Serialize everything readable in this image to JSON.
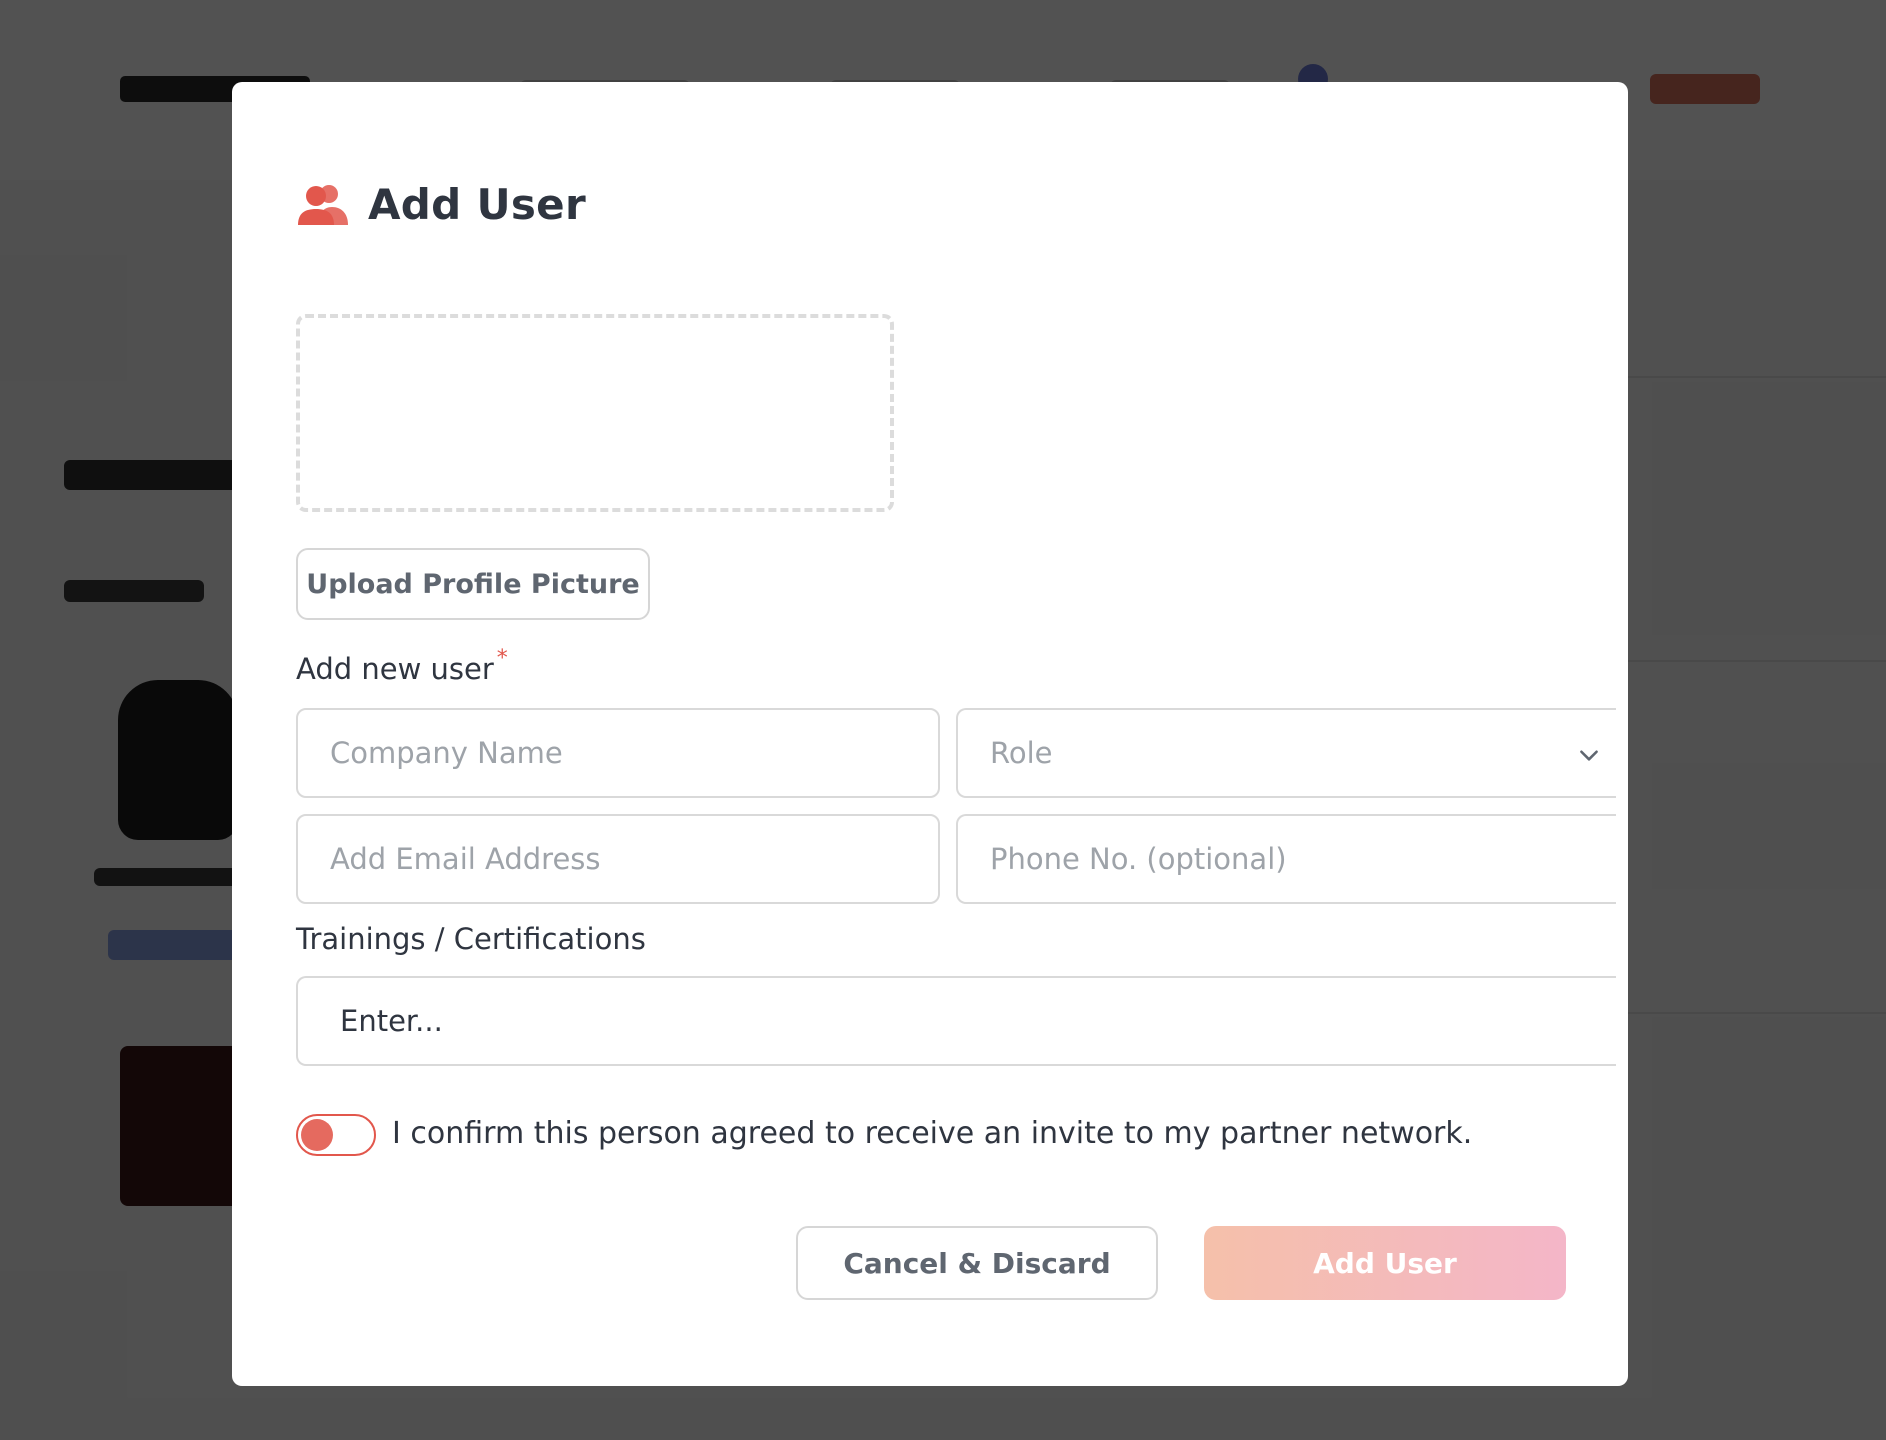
{
  "modal": {
    "title": "Add User",
    "title_icon": "users-icon",
    "upload_button_label": "Upload Profile Picture",
    "add_new_user_label": "Add new user",
    "required_mark": "*",
    "fields": {
      "company_name_placeholder": "Company Name",
      "role_value": "Role",
      "email_placeholder": "Add Email Address",
      "phone_placeholder": "Phone No. (optional)"
    },
    "trainings_label": "Trainings / Certifications",
    "trainings_placeholder": "Enter...",
    "consent_text": "I confirm this person agreed to receive an invite to my partner network.",
    "cancel_label": "Cancel & Discard",
    "submit_label": "Add User"
  },
  "colors": {
    "accent": "#e2574c",
    "title_text": "#2f3540",
    "submit_gradient_start": "#f5c0aa",
    "submit_gradient_end": "#f4b6c8",
    "overlay": "rgba(0,0,0,0.68)"
  }
}
